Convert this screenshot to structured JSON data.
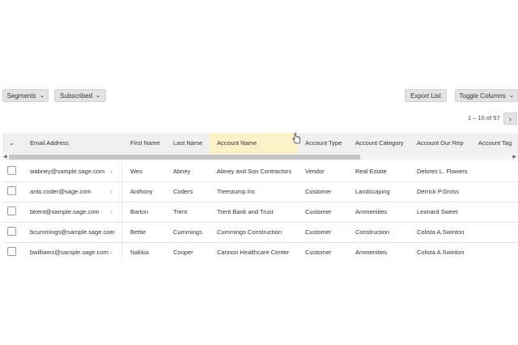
{
  "toolbar": {
    "segments_label": "Segments",
    "subscribed_label": "Subscribed",
    "export_label": "Export List",
    "toggle_columns_label": "Toggle Columns"
  },
  "pager": {
    "text": "1 – 10 of 57",
    "next_icon": "chevron-right-icon"
  },
  "table": {
    "columns": [
      "Email Address",
      "First Name",
      "Last Name",
      "Account Name",
      "Account Type",
      "Account Category",
      "Account Our Rep",
      "Account Tag"
    ],
    "highlight_color": "#fdf1c8",
    "rows": [
      {
        "email": "wabney@sample.sage.com",
        "first": "Wes",
        "last": "Abney",
        "account": "Abney and Son Contractors",
        "type": "Vendor",
        "category": "Real Estate",
        "rep": "Delores L. Flowers"
      },
      {
        "email": "anto.coder@sage.com",
        "first": "Anthony",
        "last": "Coders",
        "account": "Treestump Inc",
        "type": "Customer",
        "category": "Landscaping",
        "rep": "Derrick P.Gross"
      },
      {
        "email": "btrent@sample.sage.com",
        "first": "Barton",
        "last": "Trent",
        "account": "Trent Bank and Trust",
        "type": "Customer",
        "category": "Ammenities",
        "rep": "Leonard Sweet"
      },
      {
        "email": "bcummings@sample.sage.com",
        "first": "Bettie",
        "last": "Cummings",
        "account": "Cummings Construction",
        "type": "Customer",
        "category": "Construction",
        "rep": "Colista A.Swinton"
      },
      {
        "email": "bwilliams@sample.sage.com",
        "first": "Nakkia",
        "last": "Cooper",
        "account": "Cannon Healthcare Center",
        "type": "Customer",
        "category": "Ammenities",
        "rep": "Colista A.Swinton"
      }
    ]
  }
}
